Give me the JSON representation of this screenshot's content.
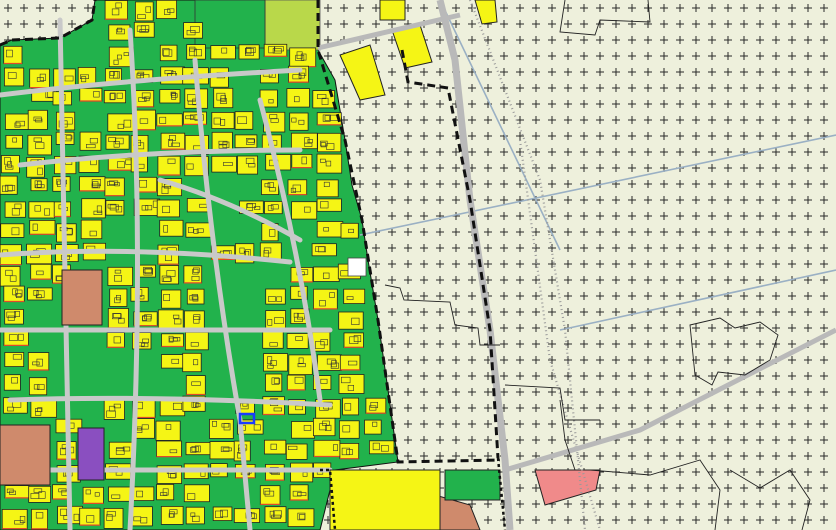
{
  "map": {
    "kind": "land-use zoning plan",
    "colors": {
      "open_land": "#eef0dc",
      "agricultural_hatch": "#2a2a2a",
      "green_space": "#22b24c",
      "residential": "#f5f515",
      "building_outline": "#222222",
      "road": "#c9c9c9",
      "road_edge": "#8f8f8f",
      "residential_front_line": "#e04a2a",
      "community_facility": "#cf8a6c",
      "community_facility_pink": "#f08a8a",
      "sports_field": "#b9d84a",
      "special_use_purple": "#8a4fc0",
      "plan_boundary": "#111111",
      "selected_parcel": "#1a3cff",
      "infrastructure_line": "#9ab0c4",
      "railway_dots": "#9a9a9a"
    },
    "legend_items_visible": [],
    "labels_visible": []
  }
}
